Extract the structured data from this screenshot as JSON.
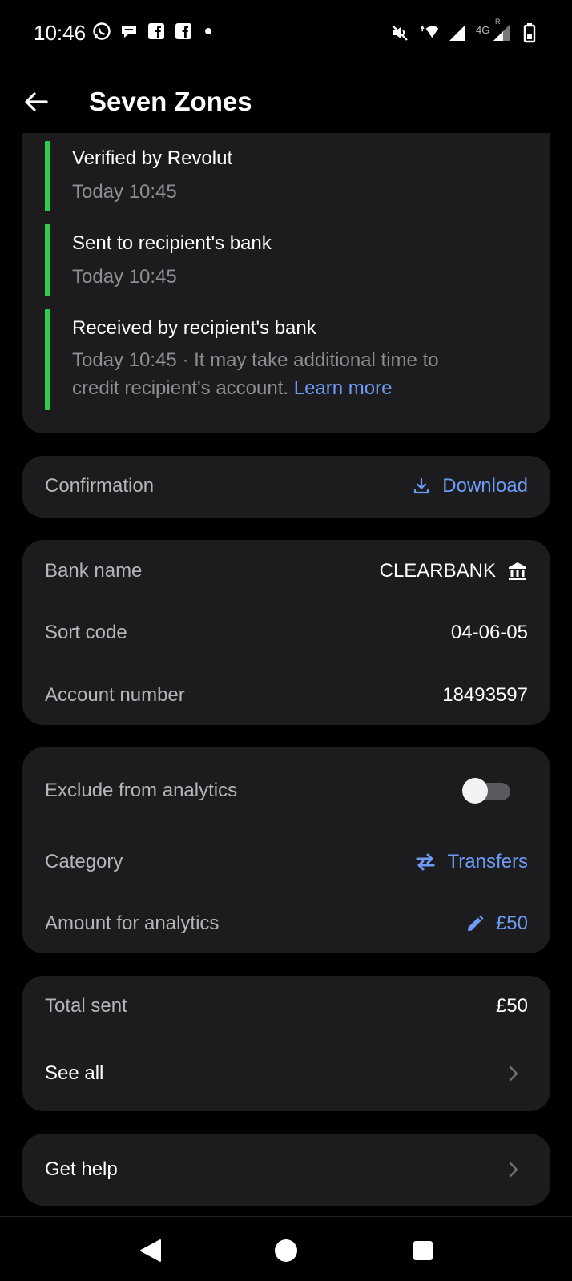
{
  "status_bar": {
    "time": "10:46",
    "left_icons": [
      "whatsapp-icon",
      "chat-bubble-icon",
      "facebook-icon",
      "facebook-icon"
    ],
    "right_icons": [
      "mute-icon",
      "wifi-icon",
      "signal-icon",
      "signal-4g-icon",
      "battery-icon"
    ],
    "network_label": "4G",
    "roaming_label": "R"
  },
  "header": {
    "title": "Seven Zones",
    "back_icon": "arrow-left-icon"
  },
  "timeline": {
    "items": [
      {
        "title": "Verified by Revolut",
        "time": "Today 10:45"
      },
      {
        "title": "Sent to recipient's bank",
        "time": "Today 10:45"
      },
      {
        "title": "Received by recipient's bank",
        "time_line1": "Today 10:45 · It may take additional time to",
        "time_line2": "credit recipient's account.",
        "link": "Learn more"
      }
    ],
    "accent_color": "#2ccf4f"
  },
  "confirmation": {
    "label": "Confirmation",
    "action": "Download",
    "action_icon": "download-icon"
  },
  "bank_details": {
    "bank_name_label": "Bank name",
    "bank_name_value": "CLEARBANK",
    "bank_icon": "bank-building-icon",
    "sort_code_label": "Sort code",
    "sort_code_value": "04-06-05",
    "account_number_label": "Account number",
    "account_number_value": "18493597"
  },
  "analytics": {
    "exclude_label": "Exclude from analytics",
    "exclude_enabled": false,
    "category_label": "Category",
    "category_value": "Transfers",
    "category_icon": "transfer-arrows-icon",
    "amount_label": "Amount for analytics",
    "amount_value": "£50",
    "amount_icon": "pencil-icon"
  },
  "totals": {
    "total_sent_label": "Total sent",
    "total_sent_value": "£50",
    "see_all_label": "See all"
  },
  "help": {
    "label": "Get help"
  },
  "colors": {
    "background": "#000000",
    "card": "#1c1c1e",
    "link": "#6e9bf5",
    "secondary_text": "#8d8d93"
  }
}
